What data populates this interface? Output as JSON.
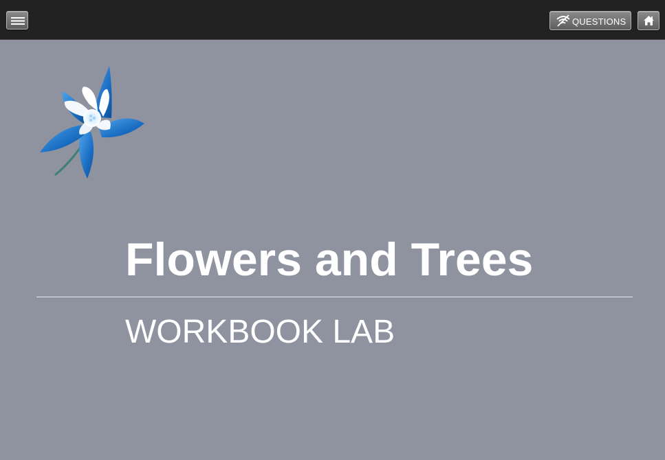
{
  "header": {
    "menu_icon": "hamburger-menu-icon",
    "questions_label": "QUESTIONS",
    "questions_icon": "wifi-off-icon",
    "home_icon": "home-icon"
  },
  "logo": {
    "icon": "columbine-flower-logo",
    "colors": {
      "petal_blue": "#1b6fc4",
      "petal_white": "#ffffff"
    }
  },
  "main": {
    "title": "Flowers and Trees",
    "subtitle": "WORKBOOK LAB"
  },
  "colors": {
    "background": "#8f929f",
    "topbar": "#222222",
    "text": "#ffffff"
  }
}
